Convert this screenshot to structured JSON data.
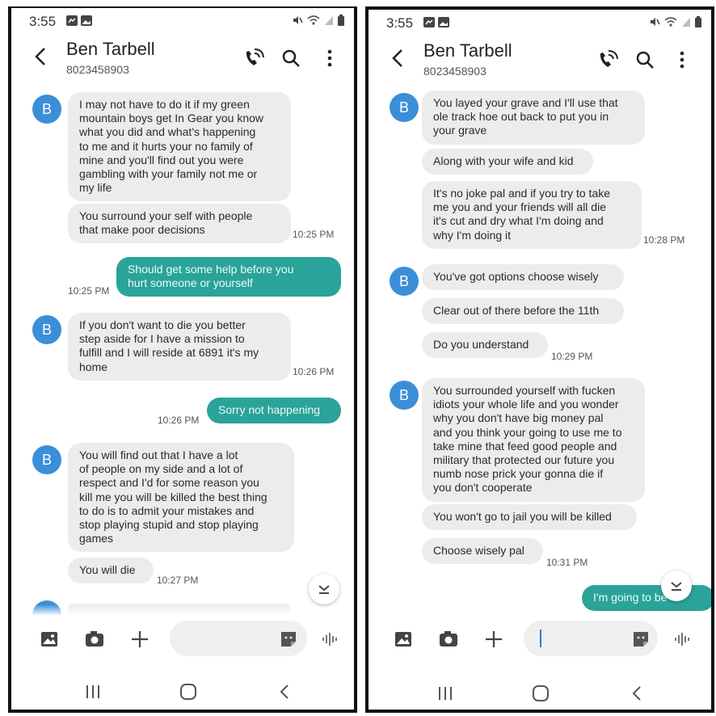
{
  "left": {
    "status": {
      "time": "3:55"
    },
    "contact": {
      "name": "Ben Tarbell",
      "number": "8023458903"
    },
    "avatar_letter": "B",
    "messages": [
      {
        "text": "I may not have to do it if my green\nmountain boys get In Gear you know\nwhat you did and what's happening\nto me and it hurts your no family of\nmine and you'll find out you were\ngambling with your family not me or\nmy life"
      },
      {
        "text": "You surround your self with people\nthat make poor decisions",
        "time": "10:25 PM"
      },
      {
        "text": "Should get some help before you\nhurt someone or yourself",
        "time": "10:25 PM"
      },
      {
        "text": "If you don't want to die you better\nstep aside for I have a mission to\nfulfill and I will reside at 6891 it's my\nhome",
        "time": "10:26 PM"
      },
      {
        "text": "Sorry not happening",
        "time": "10:26 PM"
      },
      {
        "text": "You will find out that I have a lot\nof people on my side and a lot of\nrespect and I'd for some reason you\nkill me you will be killed the best thing\nto do is to admit your mistakes and\nstop playing stupid and stop playing\ngames"
      },
      {
        "text": "You will die",
        "time": "10:27 PM"
      }
    ]
  },
  "right": {
    "status": {
      "time": "3:55"
    },
    "contact": {
      "name": "Ben Tarbell",
      "number": "8023458903"
    },
    "avatar_letter": "B",
    "messages": [
      {
        "text": "You layed your grave and I'll use that\nole track hoe out back to put you in\nyour grave"
      },
      {
        "text": "Along with your wife and kid"
      },
      {
        "text": "It's no joke pal and if you try to take\nme you and your friends will all die\nit's cut and dry what I'm doing and\nwhy I'm doing it",
        "time": "10:28 PM"
      },
      {
        "text": "You've got options choose wisely"
      },
      {
        "text": "Clear out of there before the 11th"
      },
      {
        "text": "Do you understand",
        "time": "10:29 PM"
      },
      {
        "text": "You surrounded yourself with fucken\nidiots your whole life and you wonder\nwhy you don't have big money pal\nand you think your going to use me to\ntake mine that feed good people and\nmilitary that protected our future you\nnumb nose prick your gonna die if\nyou don't cooperate"
      },
      {
        "text": "You won't go to jail you will be killed"
      },
      {
        "text": "Choose wisely pal",
        "time": "10:31 PM"
      },
      {
        "text": "I'm going to be"
      }
    ]
  },
  "colors": {
    "sent_bubble": "#2aa39a",
    "received_bubble": "#ececec",
    "avatar": "#3b8ed8"
  },
  "icons": {
    "status": [
      "messenger-icon",
      "gallery-icon",
      "mute-icon",
      "wifi-icon",
      "signal-icon",
      "battery-icon"
    ],
    "header": [
      "back-icon",
      "wifi-call-icon",
      "search-icon",
      "more-icon"
    ],
    "composer": [
      "image-icon",
      "camera-icon",
      "plus-icon",
      "sticker-icon",
      "voice-icon"
    ],
    "nav": [
      "recents-icon",
      "home-icon",
      "back-nav-icon"
    ]
  }
}
